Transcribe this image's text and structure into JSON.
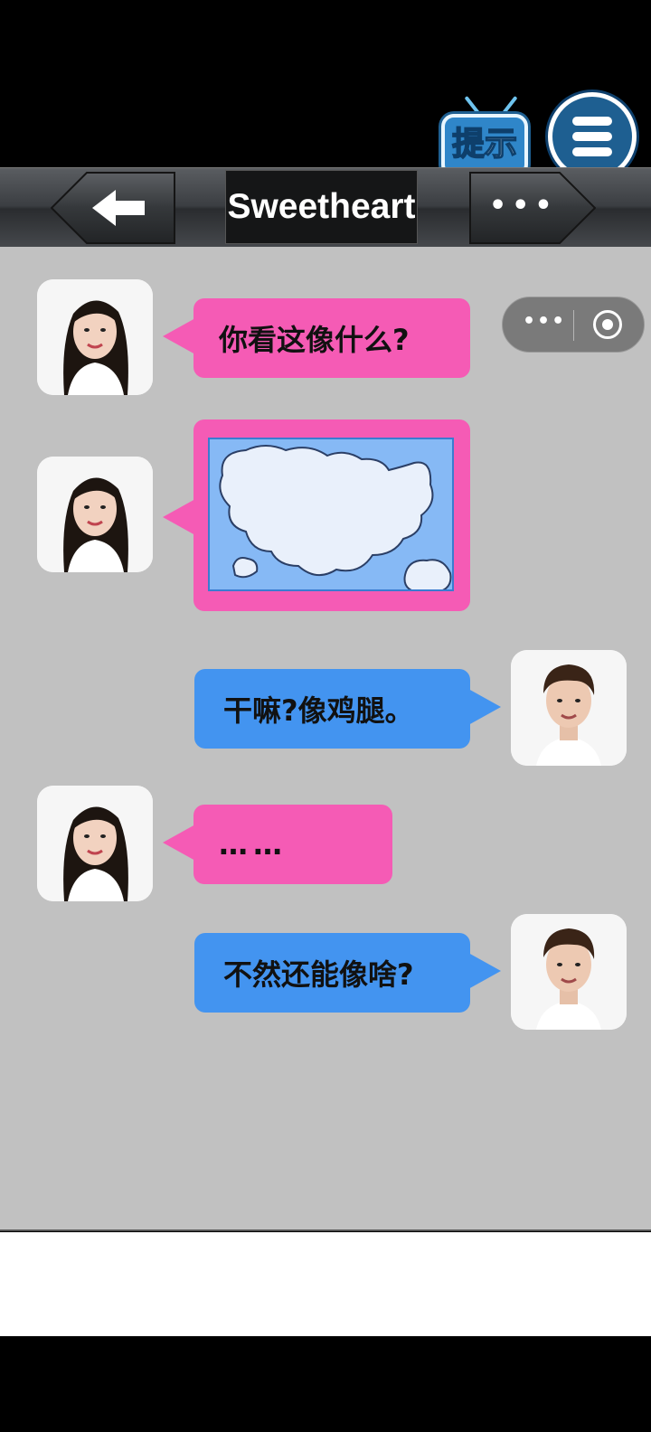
{
  "app": {
    "hint_label": "提示",
    "nav_title": "Sweetheart",
    "more_label": "•••"
  },
  "capsule": {
    "more_label": "•••"
  },
  "messages": [
    {
      "sender": "girl",
      "type": "text",
      "text": "你看这像什么?"
    },
    {
      "sender": "girl",
      "type": "image",
      "image": "heart-shaped cloud in blue sky"
    },
    {
      "sender": "boy",
      "type": "text",
      "text": "干嘛?像鸡腿。"
    },
    {
      "sender": "girl",
      "type": "text",
      "text": "……"
    },
    {
      "sender": "boy",
      "type": "text",
      "text": "不然还能像啥?"
    }
  ],
  "colors": {
    "girl_bubble": "#f55bb5",
    "boy_bubble": "#4394f0",
    "chat_bg": "#c1c1c1"
  }
}
